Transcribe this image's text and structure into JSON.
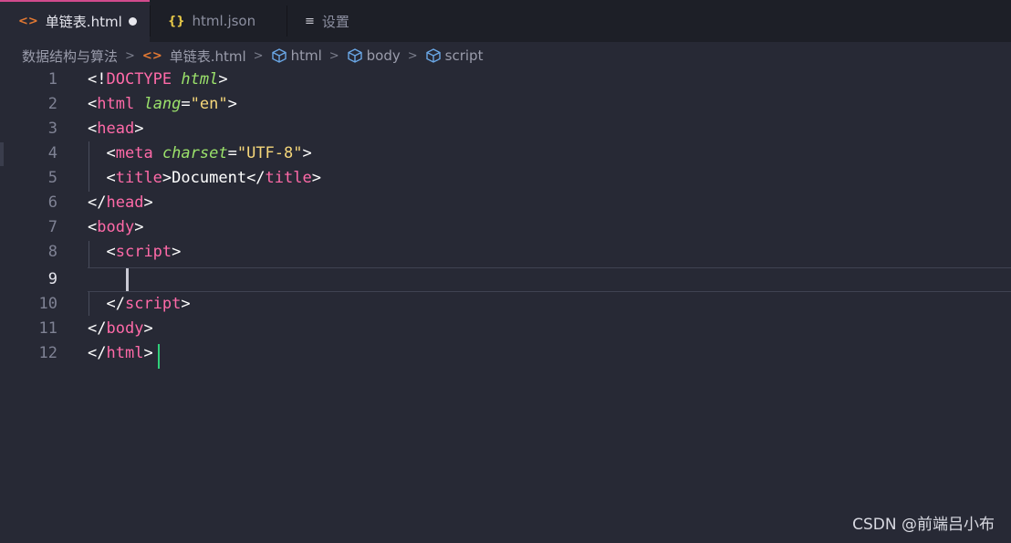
{
  "tabs": [
    {
      "label": "单链表.html",
      "icon": "html-icon",
      "active": true,
      "modified": true
    },
    {
      "label": "html.json",
      "icon": "json-icon",
      "active": false
    },
    {
      "label": "设置",
      "icon": "settings-icon",
      "active": false
    }
  ],
  "breadcrumb": {
    "folder": "数据结构与算法",
    "file": "单链表.html",
    "symbols": [
      "html",
      "body",
      "script"
    ]
  },
  "editor": {
    "line_numbers": [
      "1",
      "2",
      "3",
      "4",
      "5",
      "6",
      "7",
      "8",
      "9",
      "10",
      "11",
      "12"
    ],
    "current_line": "9",
    "lines": {
      "l1": {
        "lt": "<!",
        "doctype": "DOCTYPE",
        "html": "html",
        "gt": ">"
      },
      "l2": {
        "lt": "<",
        "tag": "html",
        "attr": "lang",
        "eq": "=",
        "val": "\"en\"",
        "gt": ">"
      },
      "l3": {
        "lt": "<",
        "tag": "head",
        "gt": ">"
      },
      "l4": {
        "lt": "<",
        "tag": "meta",
        "attr": "charset",
        "eq": "=",
        "val": "\"UTF-8\"",
        "gt": ">"
      },
      "l5": {
        "lt": "<",
        "tag": "title",
        "gt": ">",
        "text": "Document",
        "lt2": "</",
        "tag2": "title",
        "gt2": ">"
      },
      "l6": {
        "lt": "</",
        "tag": "head",
        "gt": ">"
      },
      "l7": {
        "lt": "<",
        "tag": "body",
        "gt": ">"
      },
      "l8": {
        "lt": "<",
        "tag": "script",
        "gt": ">"
      },
      "l10": {
        "lt": "</",
        "tag": "script",
        "gt": ">"
      },
      "l11": {
        "lt": "</",
        "tag": "body",
        "gt": ">"
      },
      "l12": {
        "lt": "</",
        "tag": "html",
        "gt": ">"
      }
    }
  },
  "watermark": "CSDN @前端吕小布",
  "colors": {
    "tag": "#ff6aa8",
    "attribute": "#9be26b",
    "string": "#f6d77a",
    "accent_tab": "#d14a8c",
    "background": "#272935"
  }
}
